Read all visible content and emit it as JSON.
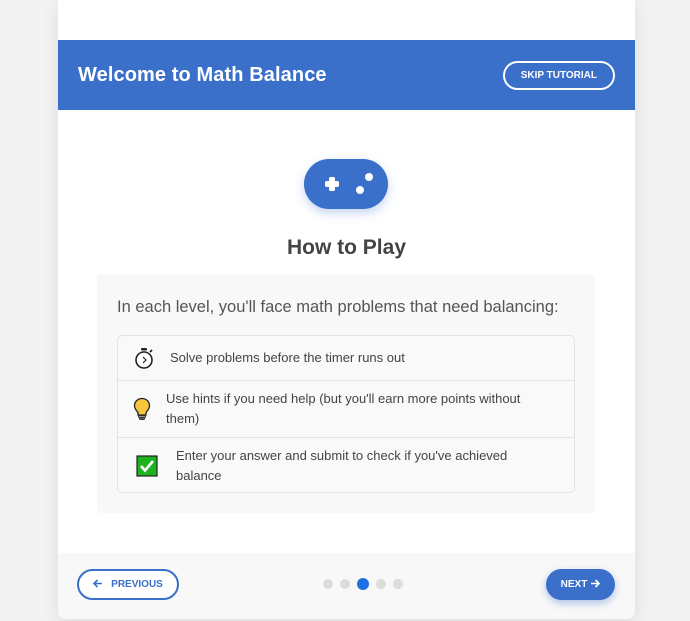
{
  "header": {
    "title": "Welcome to Math Balance",
    "skip_label": "SKIP TUTORIAL"
  },
  "main": {
    "icon": "gamepad-icon",
    "title": "How to Play",
    "intro": "In each level, you'll face math problems that need balancing:",
    "items": [
      {
        "icon": "stopwatch-icon",
        "text": "Solve problems before the timer runs out"
      },
      {
        "icon": "lightbulb-icon",
        "text": "Use hints if you need help (but you'll earn more points without them)"
      },
      {
        "icon": "checkmark-icon",
        "text": "Enter your answer and submit to check if you've achieved balance"
      }
    ]
  },
  "footer": {
    "previous_label": "PREVIOUS",
    "next_label": "NEXT",
    "steps_total": 5,
    "current_step": 3
  },
  "colors": {
    "primary": "#3a6fca",
    "active_dot": "#1e6fe0",
    "check_green": "#1db320"
  }
}
